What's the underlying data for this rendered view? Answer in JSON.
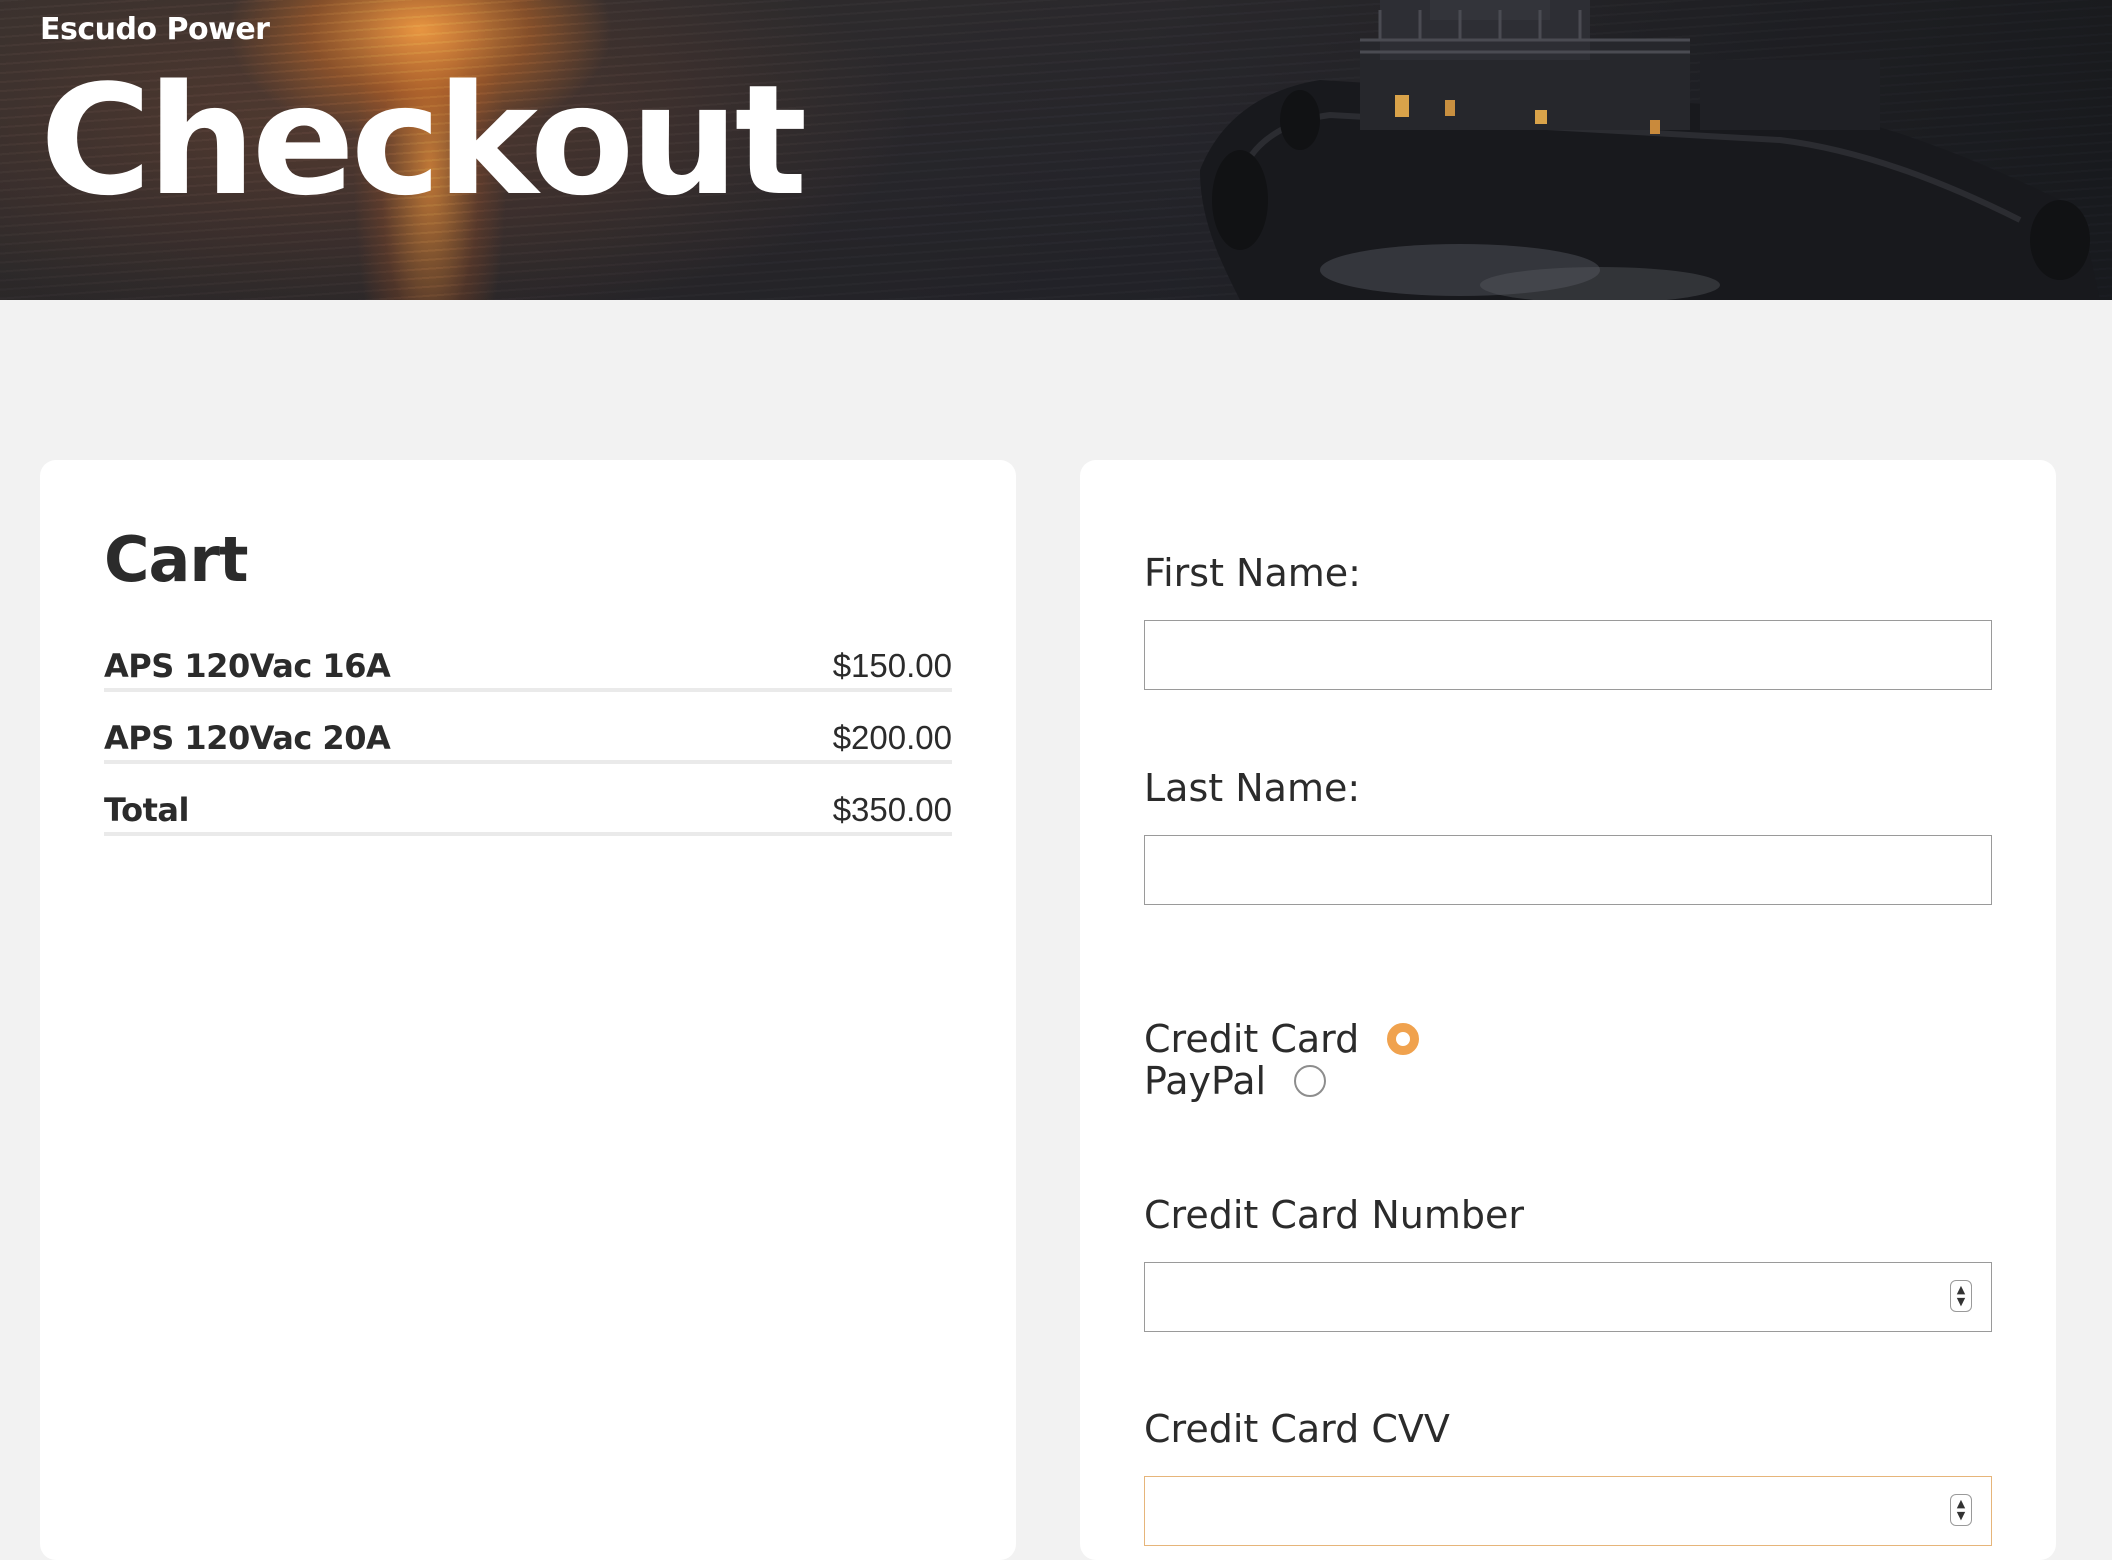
{
  "header": {
    "brand": "Escudo Power",
    "title": "Checkout"
  },
  "cart": {
    "title": "Cart",
    "items": [
      {
        "name": "APS 120Vac 16A",
        "price": "$150.00"
      },
      {
        "name": "APS 120Vac 20A",
        "price": "$200.00"
      }
    ],
    "total_label": "Total",
    "total_value": "$350.00"
  },
  "form": {
    "first_name_label": "First Name:",
    "first_name_value": "",
    "last_name_label": "Last Name:",
    "last_name_value": "",
    "payment_options": [
      {
        "label": "Credit Card",
        "selected": true
      },
      {
        "label": "PayPal",
        "selected": false
      }
    ],
    "cc_number_label": "Credit Card Number",
    "cc_number_value": "",
    "cc_cvv_label": "Credit Card CVV",
    "cc_cvv_value": ""
  },
  "colors": {
    "accent": "#f0a24e",
    "background": "#f2f2f2",
    "card": "#ffffff",
    "text": "#2b2b2b"
  }
}
